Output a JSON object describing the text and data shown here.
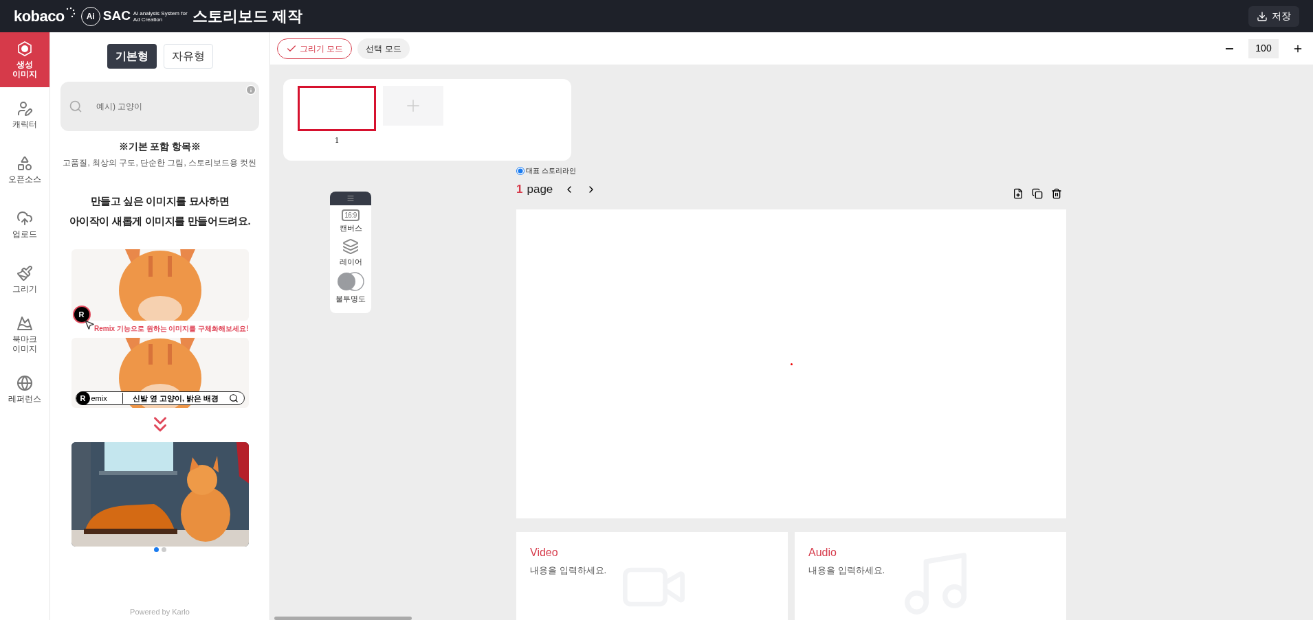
{
  "header": {
    "logo": "kobaco",
    "sac": "SAC",
    "sac_badge": "Ai",
    "sac_sub": "Ai analysis System for Ad Creation",
    "title": "스토리보드 제작",
    "save_button": "저장"
  },
  "nav": [
    {
      "kind": "ai",
      "label": "생성\n이미지",
      "selected": true
    },
    {
      "kind": "character",
      "label": "캐릭터",
      "selected": false
    },
    {
      "kind": "opensource",
      "label": "오픈소스",
      "selected": false
    },
    {
      "kind": "upload",
      "label": "업로드",
      "selected": false
    },
    {
      "kind": "draw",
      "label": "그리기",
      "selected": false
    },
    {
      "kind": "bookmark",
      "label": "북마크\n이미지",
      "selected": false
    },
    {
      "kind": "reference",
      "label": "레퍼런스",
      "selected": false
    }
  ],
  "panel": {
    "tabs": [
      {
        "label": "기본형",
        "selected": true
      },
      {
        "label": "자유형",
        "selected": false
      }
    ],
    "search": {
      "placeholder": "예시) 고양이"
    },
    "included_title": "※기본 포함 항목※",
    "included_items": "고품질, 최상의 구도, 단순한 그림, 스토리보드용 컷씬",
    "promo_lines": [
      "만들고 싶은 이미지를 묘사하면",
      "아이작이 새롭게 이미지를 만들어드려요."
    ],
    "remix_caption": "Remix 기능으로 원하는 이미지를 구체화해보세요!",
    "remix_badge": "R",
    "remix_bar_badge": "R",
    "remix_label": "emix",
    "remix_query": "신발 옆 고양이, 밝은 배경",
    "dots": [
      {
        "selected": true
      },
      {
        "selected": false
      }
    ],
    "powered": "Powered by Karlo"
  },
  "toolbar": {
    "modes": [
      {
        "label": "그리기 모드",
        "selected": true
      },
      {
        "label": "선택 모드",
        "selected": false
      }
    ],
    "zoom": "100"
  },
  "thumbnails": [
    {
      "number": "1",
      "selected": true
    }
  ],
  "storyline": {
    "label": "대표 스토리라인",
    "checked": true
  },
  "page": {
    "number": "1",
    "label": "page"
  },
  "tools": [
    {
      "kind": "canvas",
      "label": "캔버스",
      "badge": "16:9"
    },
    {
      "kind": "layer",
      "label": "레이어"
    },
    {
      "kind": "opacity",
      "label": "불투명도"
    }
  ],
  "cards": [
    {
      "kind": "video",
      "title": "Video",
      "placeholder": "내용을 입력하세요."
    },
    {
      "kind": "audio",
      "title": "Audio",
      "placeholder": "내용을 입력하세요."
    }
  ]
}
